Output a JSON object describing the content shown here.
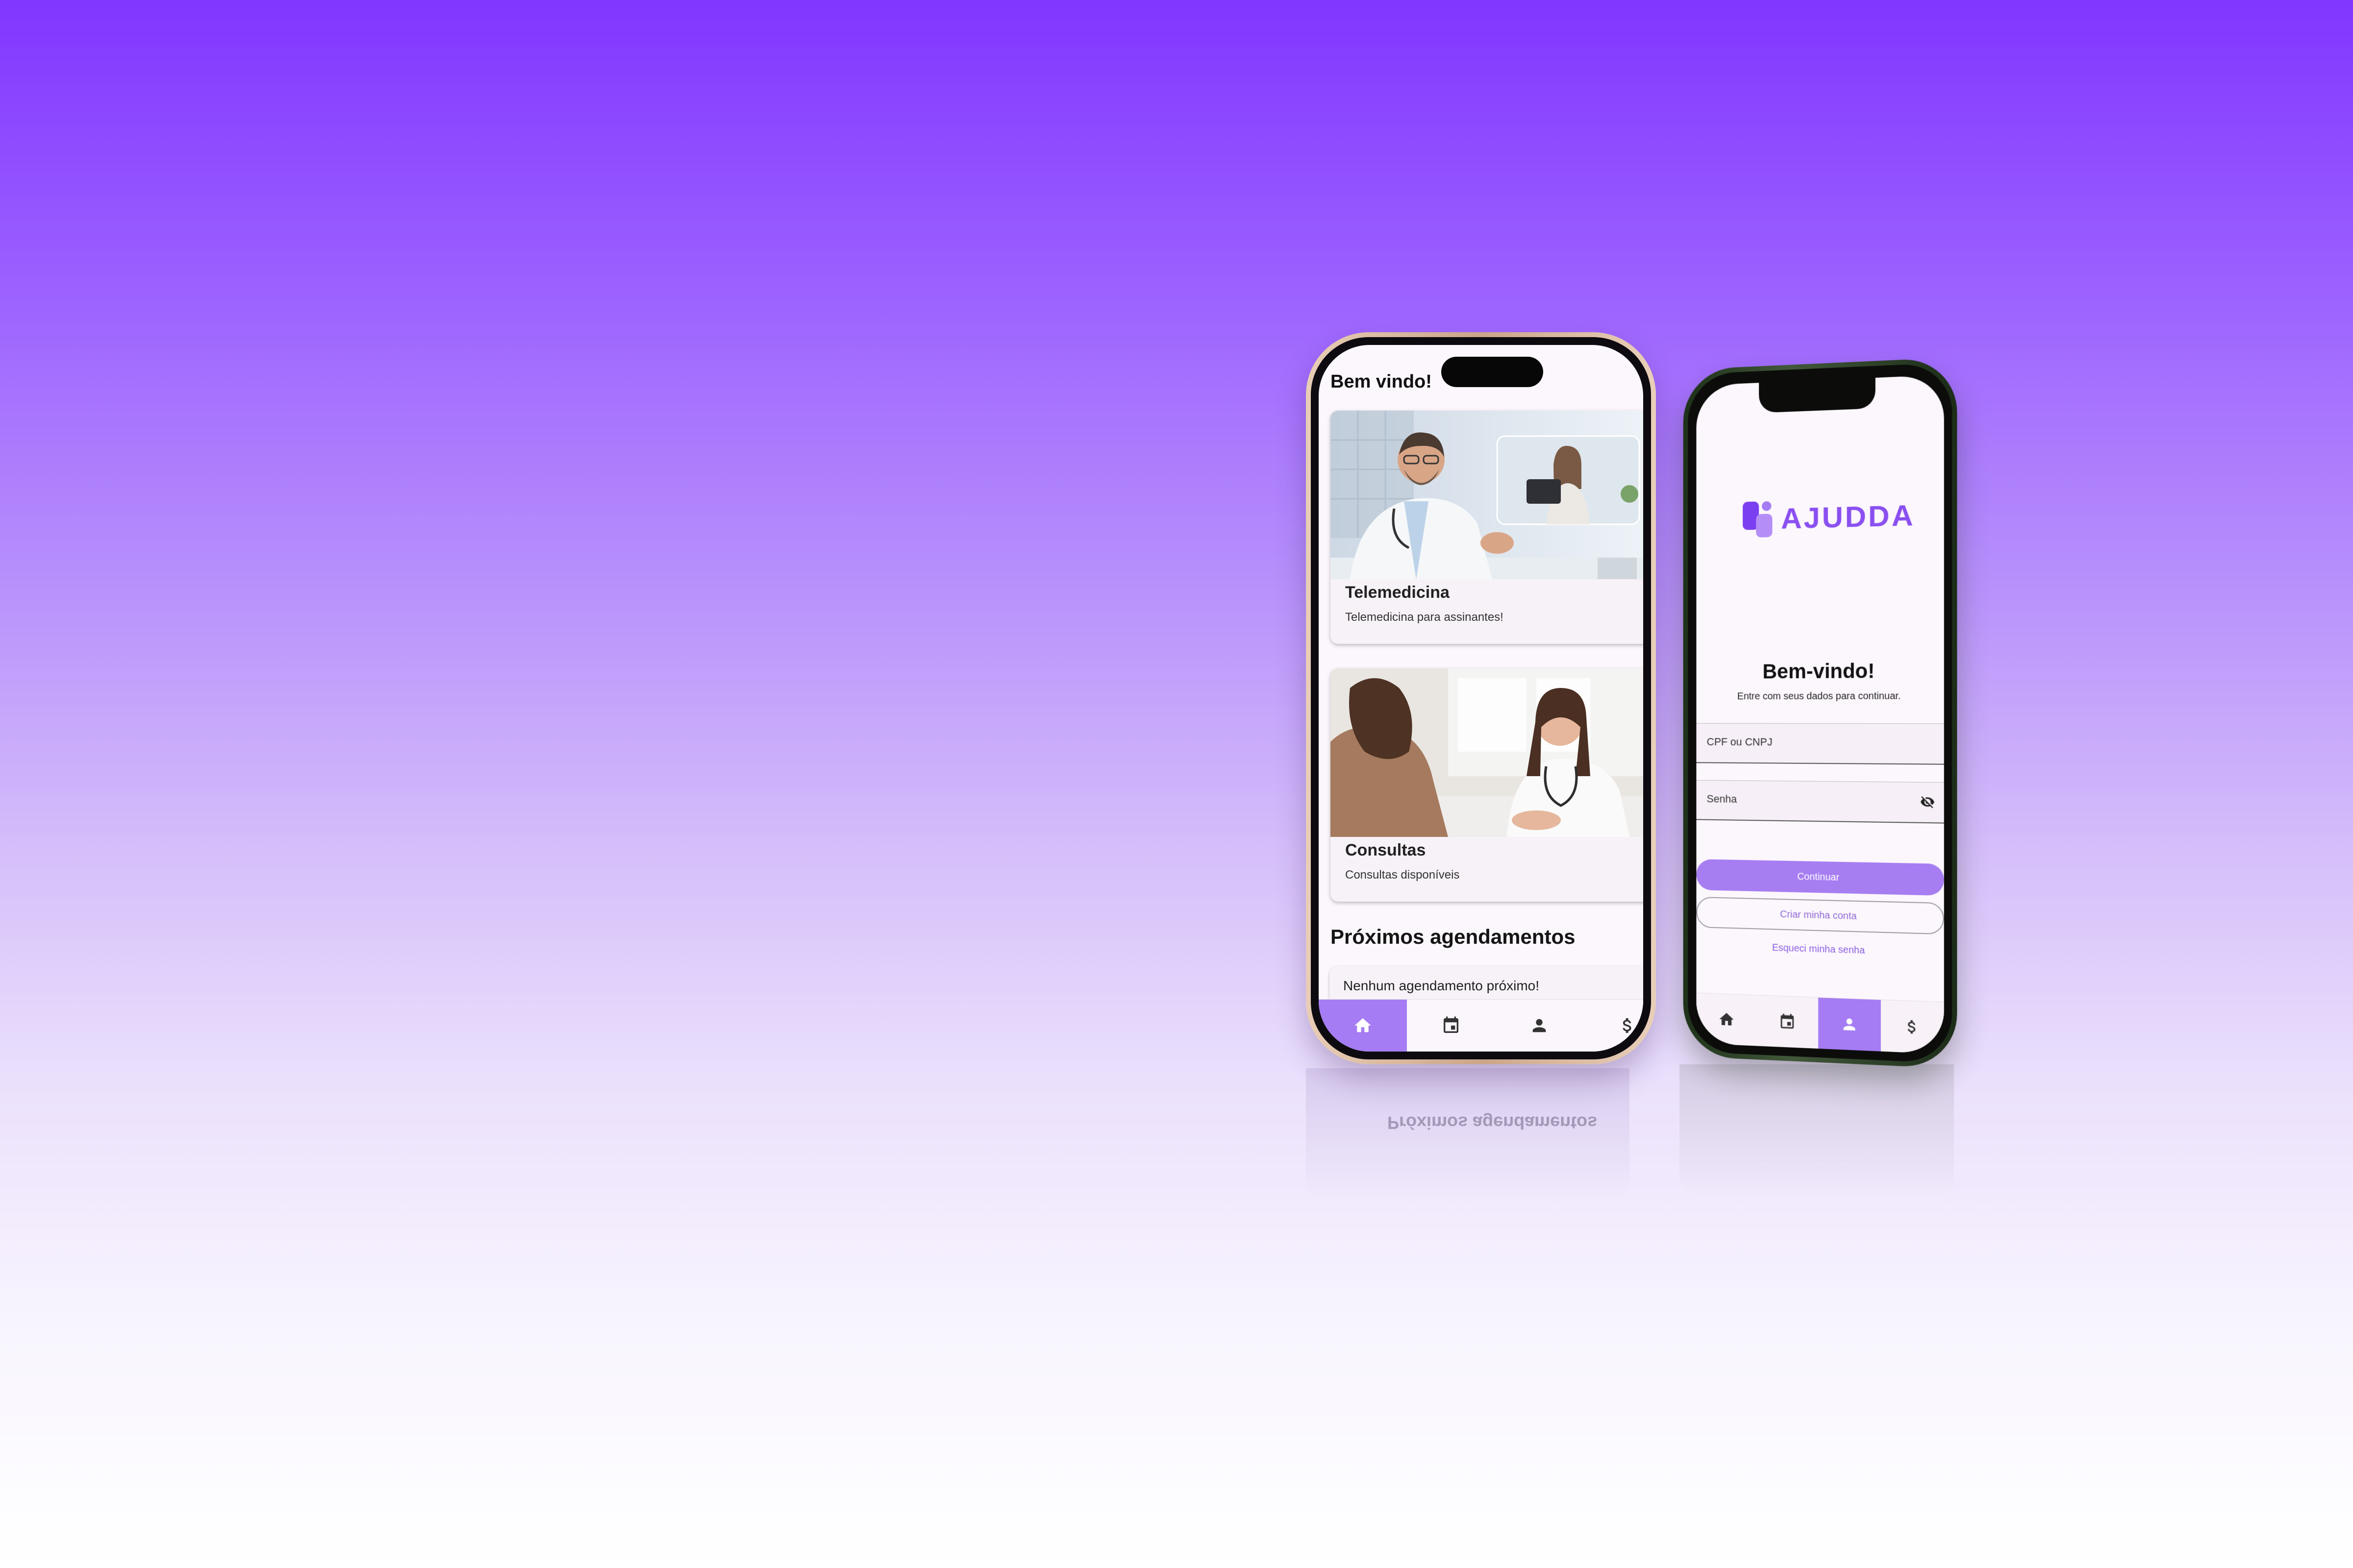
{
  "home": {
    "title": "Bem vindo!",
    "cards": [
      {
        "title": "Telemedicina",
        "subtitle": "Telemedicina para assinantes!"
      },
      {
        "title": "Consultas",
        "subtitle": "Consultas disponíveis"
      }
    ],
    "section_title": "Próximos agendamentos",
    "empty_message": "Nenhum agendamento próximo!",
    "nav": [
      "home-icon",
      "calendar-icon",
      "person-icon",
      "dollar-icon"
    ],
    "active_nav": 0
  },
  "login": {
    "logo_text": "AJUDDA",
    "title": "Bem-vindo!",
    "subtitle": "Entre com seus dados para continuar.",
    "cpf_placeholder": "CPF ou CNPJ",
    "password_placeholder": "Senha",
    "continue_label": "Continuar",
    "create_account_label": "Criar minha conta",
    "forgot_label": "Esqueci minha senha",
    "nav": [
      "home-icon",
      "calendar-icon",
      "person-icon",
      "dollar-icon"
    ],
    "active_nav": 2
  },
  "colors": {
    "accent": "#a57cf3",
    "brand": "#8a4ff0",
    "background_top": "#8236ff"
  }
}
